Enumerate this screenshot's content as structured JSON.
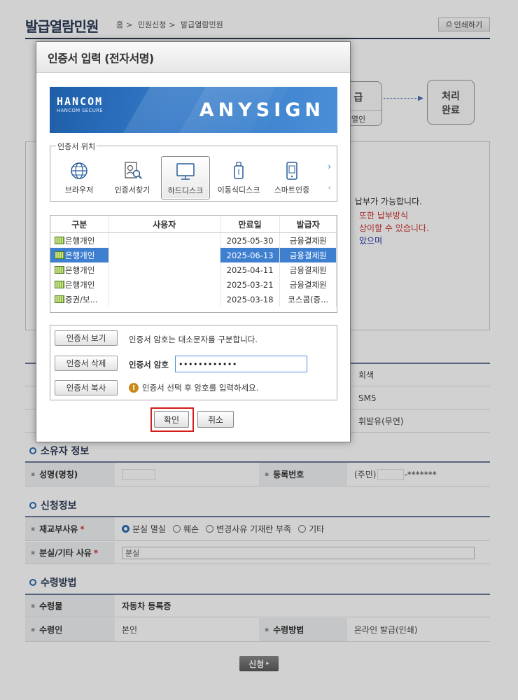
{
  "page": {
    "title": "발급열람민원",
    "breadcrumb": [
      "홈",
      "민원신청",
      "발급열람민원"
    ],
    "print_label": "인쇄하기"
  },
  "steps": {
    "step_partial_top": "급",
    "step_partial_bottom": "열인",
    "final_line1": "처리",
    "final_line2": "완료"
  },
  "info_panel": {
    "line1": "납부가 가능합니다.",
    "line2": "또한 납부방식",
    "line3": "상이할 수 있습니다.",
    "line4": "았으며"
  },
  "vehicle_partial": {
    "color": "회색",
    "model": "SM5",
    "fuel": "휘발유(무연)"
  },
  "owner": {
    "section_title": "소유자 정보",
    "name_label": "성명(명칭)",
    "reg_label": "등록번호",
    "reg_prefix": "(주민)",
    "reg_suffix": "-*******"
  },
  "request": {
    "section_title": "신청정보",
    "reason_label": "재교부사유",
    "reasons": [
      "분실 멸실",
      "훼손",
      "변경사유 기재란 부족",
      "기타"
    ],
    "selected_reason": "분실 멸실",
    "other_label": "분실/기타 사유",
    "other_value": "분실"
  },
  "receive": {
    "section_title": "수령방법",
    "item_label": "수령물",
    "item_value": "자동차 등록증",
    "receiver_label": "수령인",
    "receiver_value": "본인",
    "method_label": "수령방법",
    "method_value": "온라인 발급(인쇄)"
  },
  "submit_label": "신청",
  "dialog": {
    "title": "인증서 입력 (전자서명)",
    "banner_brand": "HANCOM",
    "banner_brand_sub": "HANCOM SECURE",
    "banner_product": "ANYSIGN",
    "location_legend": "인증서 위치",
    "locations": [
      {
        "label": "브라우저",
        "icon": "globe-icon"
      },
      {
        "label": "인증서찾기",
        "icon": "cert-search-icon"
      },
      {
        "label": "하드디스크",
        "icon": "monitor-icon",
        "selected": true
      },
      {
        "label": "이동식디스크",
        "icon": "usb-icon"
      },
      {
        "label": "스마트인증",
        "icon": "smartphone-icon"
      }
    ],
    "table": {
      "headers": [
        "구분",
        "사용자",
        "만료일",
        "발급자"
      ],
      "rows": [
        {
          "type": "은행개인",
          "user": "",
          "expiry": "2025-05-30",
          "issuer": "금융결제원",
          "selected": false
        },
        {
          "type": "은행개인",
          "user": "",
          "expiry": "2025-06-13",
          "issuer": "금융결제원",
          "selected": true
        },
        {
          "type": "은행개인",
          "user": "",
          "expiry": "2025-04-11",
          "issuer": "금융결제원",
          "selected": false
        },
        {
          "type": "은행개인",
          "user": "",
          "expiry": "2025-03-21",
          "issuer": "금융결제원",
          "selected": false
        },
        {
          "type": "증권/보...",
          "user": "",
          "expiry": "2025-03-18",
          "issuer": "코스콤(증...",
          "selected": false
        }
      ]
    },
    "view_cert": "인증서 보기",
    "delete_cert": "인증서 삭제",
    "copy_cert": "인증서 복사",
    "case_note": "인증서 암호는 대소문자를 구분합니다.",
    "password_label": "인증서 암호",
    "password_value": "••••••••••••",
    "warning": "인증서 선택 후 암호를 입력하세요.",
    "ok": "확인",
    "cancel": "취소"
  }
}
